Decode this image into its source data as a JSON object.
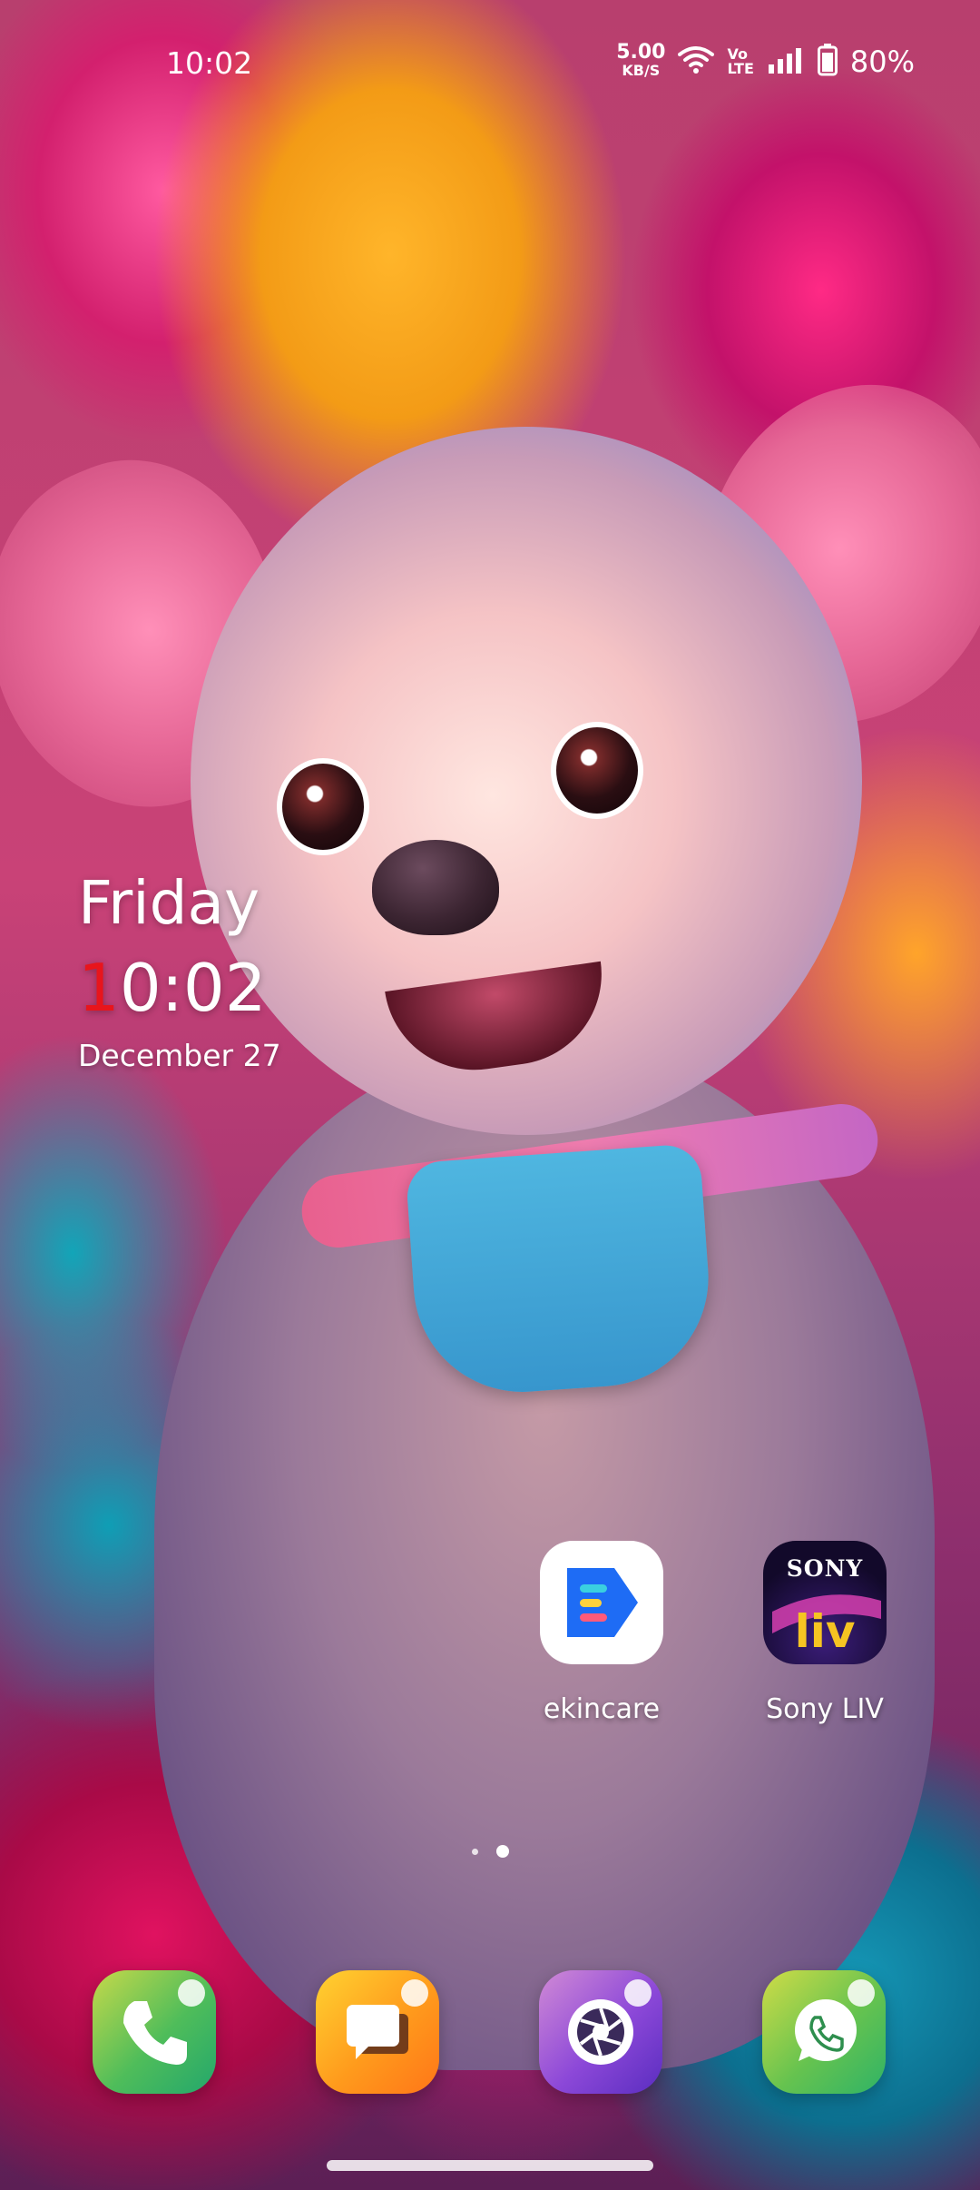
{
  "status_bar": {
    "time": "10:02",
    "net_speed_value": "5.00",
    "net_speed_unit": "KB/S",
    "volte_top": "Vo",
    "volte_bottom": "LTE",
    "battery_percent": "80%",
    "icons": [
      "wifi-icon",
      "signal-icon",
      "battery-icon"
    ]
  },
  "clock_widget": {
    "day": "Friday",
    "time_first_digit": "1",
    "time_rest": "0:02",
    "date": "December 27",
    "accent_color": "#e8151c"
  },
  "apps": [
    {
      "label": "ekincare",
      "icon": "ekincare-icon",
      "brand_color": "#1e6cf5"
    },
    {
      "label": "Sony LIV",
      "icon": "sony-liv-icon",
      "icon_top_text": "SONY",
      "icon_bottom_text": "liv"
    }
  ],
  "page_indicator": {
    "pages": 2,
    "current": 2
  },
  "dock": [
    {
      "app": "phone",
      "icon": "phone-icon"
    },
    {
      "app": "messages",
      "icon": "messages-icon"
    },
    {
      "app": "camera",
      "icon": "camera-icon"
    },
    {
      "app": "whatsapp",
      "icon": "whatsapp-icon"
    }
  ],
  "wallpaper": {
    "subject": "puppy-with-balloons-wallpaper"
  }
}
